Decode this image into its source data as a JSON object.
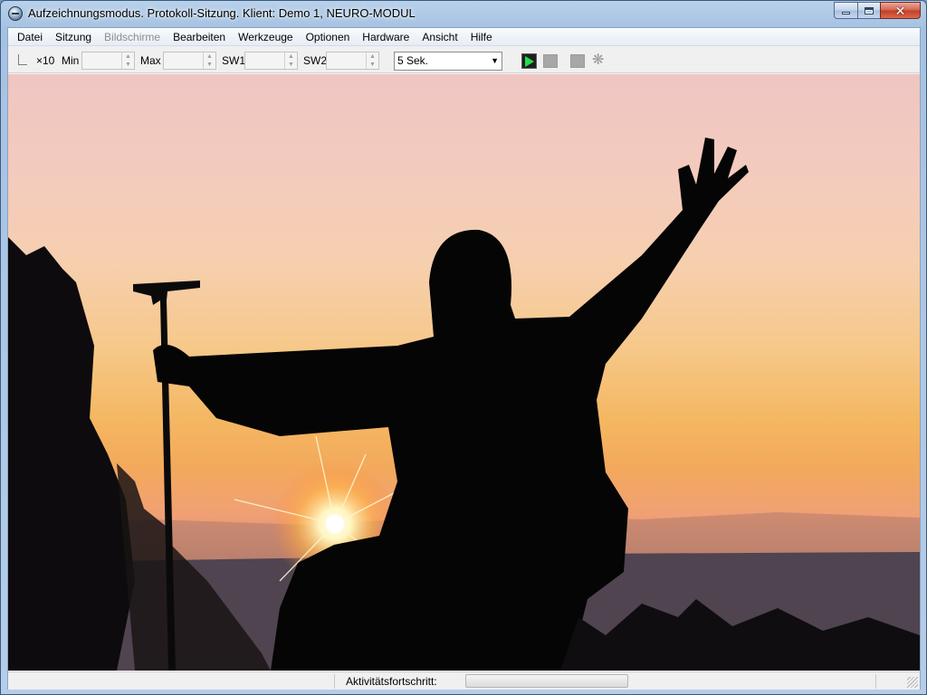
{
  "window": {
    "title": "Aufzeichnungsmodus. Protokoll-Sitzung. Klient: Demo 1, NEURO-MODUL",
    "icon": "app-logo-icon"
  },
  "menu": {
    "items": [
      {
        "label": "Datei",
        "enabled": true
      },
      {
        "label": "Sitzung",
        "enabled": true
      },
      {
        "label": "Bildschirme",
        "enabled": false
      },
      {
        "label": "Bearbeiten",
        "enabled": true
      },
      {
        "label": "Werkzeuge",
        "enabled": true
      },
      {
        "label": "Optionen",
        "enabled": true
      },
      {
        "label": "Hardware",
        "enabled": true
      },
      {
        "label": "Ansicht",
        "enabled": true
      },
      {
        "label": "Hilfe",
        "enabled": true
      }
    ]
  },
  "toolbar": {
    "scale_label": "×10",
    "min_label": "Min",
    "min_value": "",
    "max_label": "Max",
    "max_value": "",
    "sw1_label": "SW1",
    "sw1_value": "",
    "sw2_label": "SW2",
    "sw2_value": "",
    "interval_selected": "5 Sek.",
    "play_color": "#23e04a"
  },
  "statusbar": {
    "progress_label": "Aktivitätsfortschritt:",
    "progress_fraction": 0.0
  }
}
